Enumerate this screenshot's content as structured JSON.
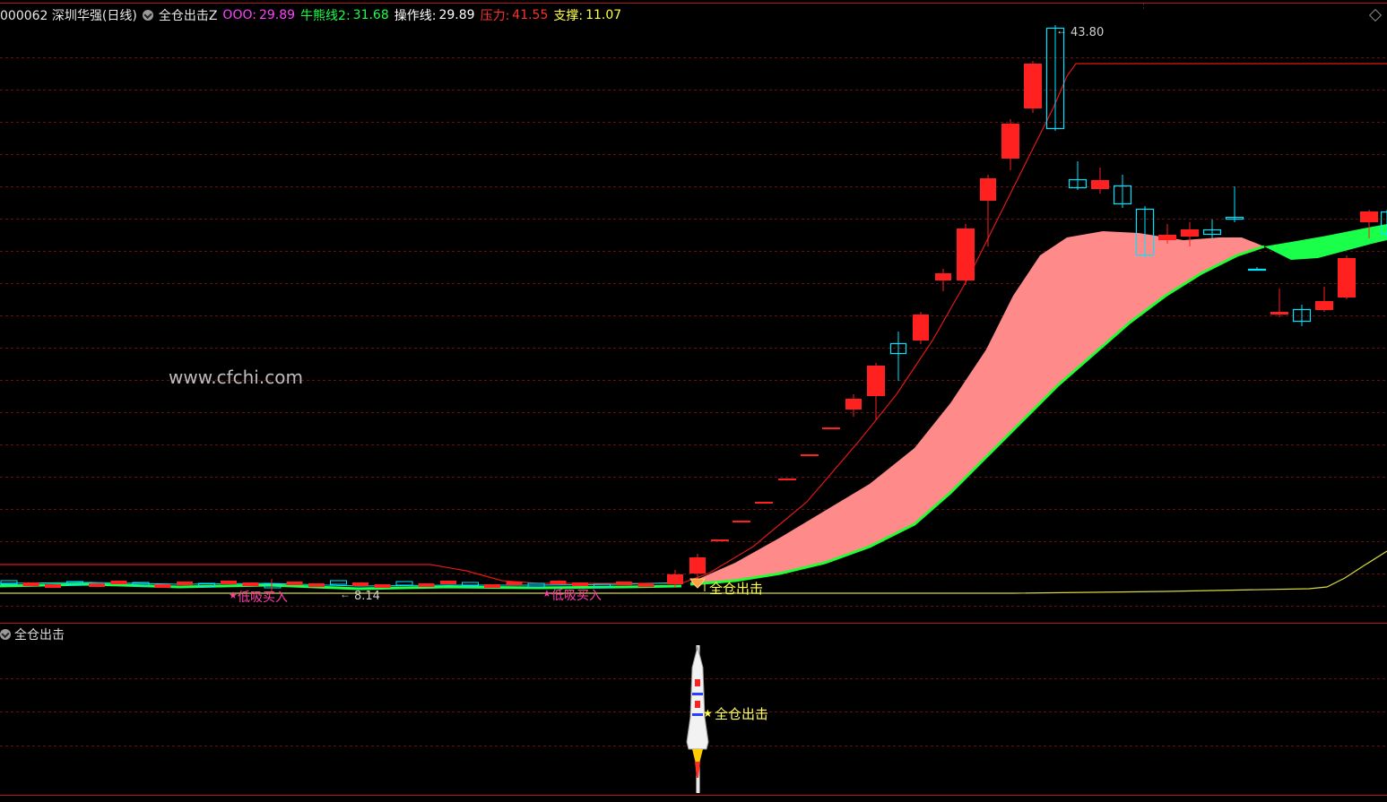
{
  "header": {
    "symbol": "000062 深圳华强(日线)",
    "indicator": "全仓出击Z",
    "ooo_label": "OOO:",
    "ooo_value": "29.89",
    "bull_label": "牛熊线2:",
    "bull_value": "31.68",
    "op_label": "操作线:",
    "op_value": "29.89",
    "press_label": "压力:",
    "press_value": "41.55",
    "support_label": "支撑:",
    "support_value": "11.07"
  },
  "main": {
    "high_price_label": "43.80",
    "low_price_label": "8.14",
    "watermark": "www.cfchi.com",
    "signal_buy_1": "低吸买入",
    "signal_buy_2": "低吸买入",
    "signal_full": "全仓出击"
  },
  "sub": {
    "title": "全仓出击",
    "rocket_label": "全仓出击"
  },
  "colors": {
    "up": "#ff2020",
    "down": "#00e5ff",
    "pink_fill": "#ff8a8a",
    "green_fill": "#19ff4a",
    "yellow": "#ffff44",
    "grid": "#6a0d0d"
  }
}
